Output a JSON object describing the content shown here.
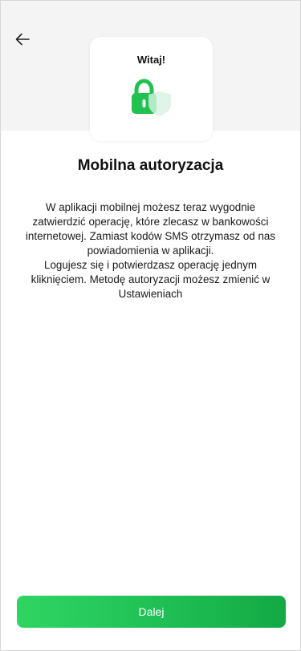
{
  "header": {
    "back_icon": "arrow-left-icon"
  },
  "card": {
    "title": "Witaj!",
    "icon": "lock-shield-icon"
  },
  "main": {
    "title": "Mobilna autoryzacja",
    "paragraph_1": "W aplikacji mobilnej możesz teraz wygodnie zatwierdzić operację, które zlecasz w bankowości internetowej. Zamiast kodów SMS otrzymasz od nas powiadomienia w aplikacji.",
    "paragraph_2": "Logujesz się i potwierdzasz operację jednym kliknięciem. Metodę autoryzacji możesz zmienić w Ustawieniach"
  },
  "footer": {
    "next_label": "Dalej"
  },
  "colors": {
    "accent": "#22c55e",
    "accent_dark": "#13a944",
    "band": "#f4f4f4"
  }
}
